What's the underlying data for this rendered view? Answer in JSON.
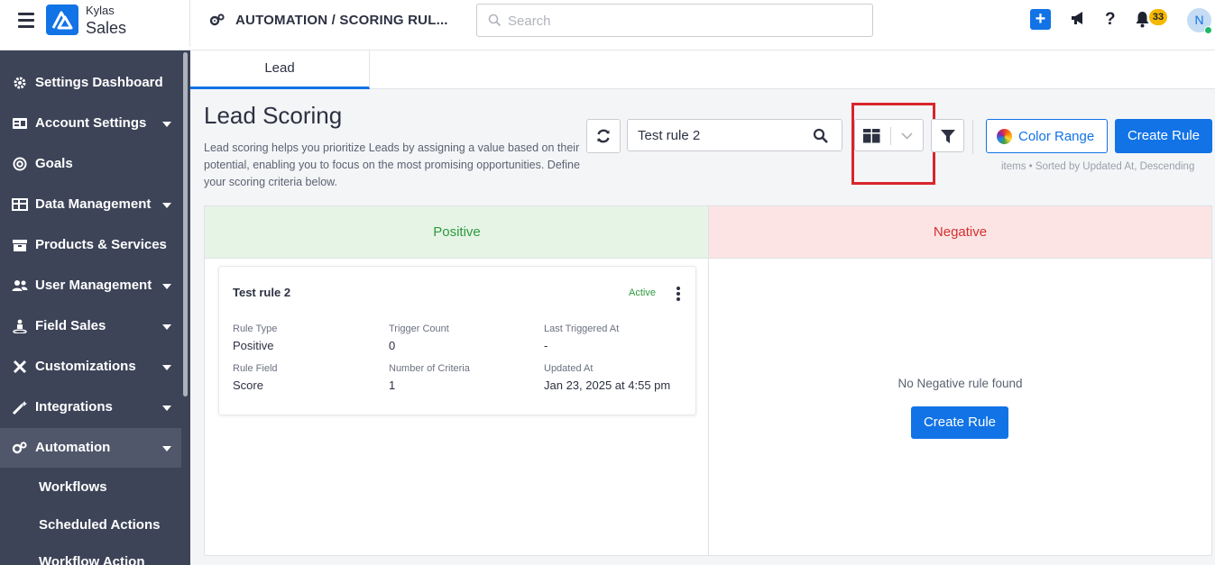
{
  "app": {
    "brand_top": "Kylas",
    "brand_bottom": "Sales",
    "breadcrumb": "AUTOMATION / SCORING RUL...",
    "search_placeholder": "Search",
    "notification_count": "33",
    "avatar_initial": "N",
    "accent_color": "#1273e6"
  },
  "sidebar": {
    "items": [
      {
        "label": "Settings Dashboard",
        "icon": "gear-icon",
        "has_caret": false
      },
      {
        "label": "Account Settings",
        "icon": "id-card-icon",
        "has_caret": true
      },
      {
        "label": "Goals",
        "icon": "target-icon",
        "has_caret": false
      },
      {
        "label": "Data Management",
        "icon": "table-icon",
        "has_caret": true
      },
      {
        "label": "Products & Services",
        "icon": "box-icon",
        "has_caret": false
      },
      {
        "label": "User Management",
        "icon": "users-icon",
        "has_caret": true
      },
      {
        "label": "Field Sales",
        "icon": "person-pin-icon",
        "has_caret": true
      },
      {
        "label": "Customizations",
        "icon": "tools-icon",
        "has_caret": true
      },
      {
        "label": "Integrations",
        "icon": "magic-wand-icon",
        "has_caret": true
      },
      {
        "label": "Automation",
        "icon": "gears-icon",
        "has_caret": true
      }
    ],
    "sub_items": [
      "Workflows",
      "Scheduled Actions",
      "Workflow Action"
    ]
  },
  "tabs": [
    {
      "label": "Lead"
    }
  ],
  "page": {
    "title": "Lead Scoring",
    "description": "Lead scoring helps you prioritize Leads by assigning a value based on their potential, enabling you to focus on the most promising opportunities. Define your scoring criteria below."
  },
  "toolbar": {
    "search_value": "Test rule 2",
    "color_range_label": "Color Range",
    "create_rule_label": "Create Rule",
    "items_info": "items • Sorted by Updated At, Descending"
  },
  "board": {
    "positive_header": "Positive",
    "negative_header": "Negative",
    "positive_color": "#2e9a3c",
    "negative_color": "#d32f2f",
    "card": {
      "title": "Test rule 2",
      "status": "Active",
      "fields": [
        {
          "label": "Rule Type",
          "value": "Positive"
        },
        {
          "label": "Trigger Count",
          "value": "0"
        },
        {
          "label": "Last Triggered At",
          "value": "-"
        },
        {
          "label": "Rule Field",
          "value": "Score"
        },
        {
          "label": "Number of Criteria",
          "value": "1"
        },
        {
          "label": "Updated At",
          "value": "Jan 23, 2025 at 4:55 pm"
        }
      ]
    },
    "negative_empty_text": "No Negative rule found",
    "negative_create_label": "Create Rule"
  }
}
